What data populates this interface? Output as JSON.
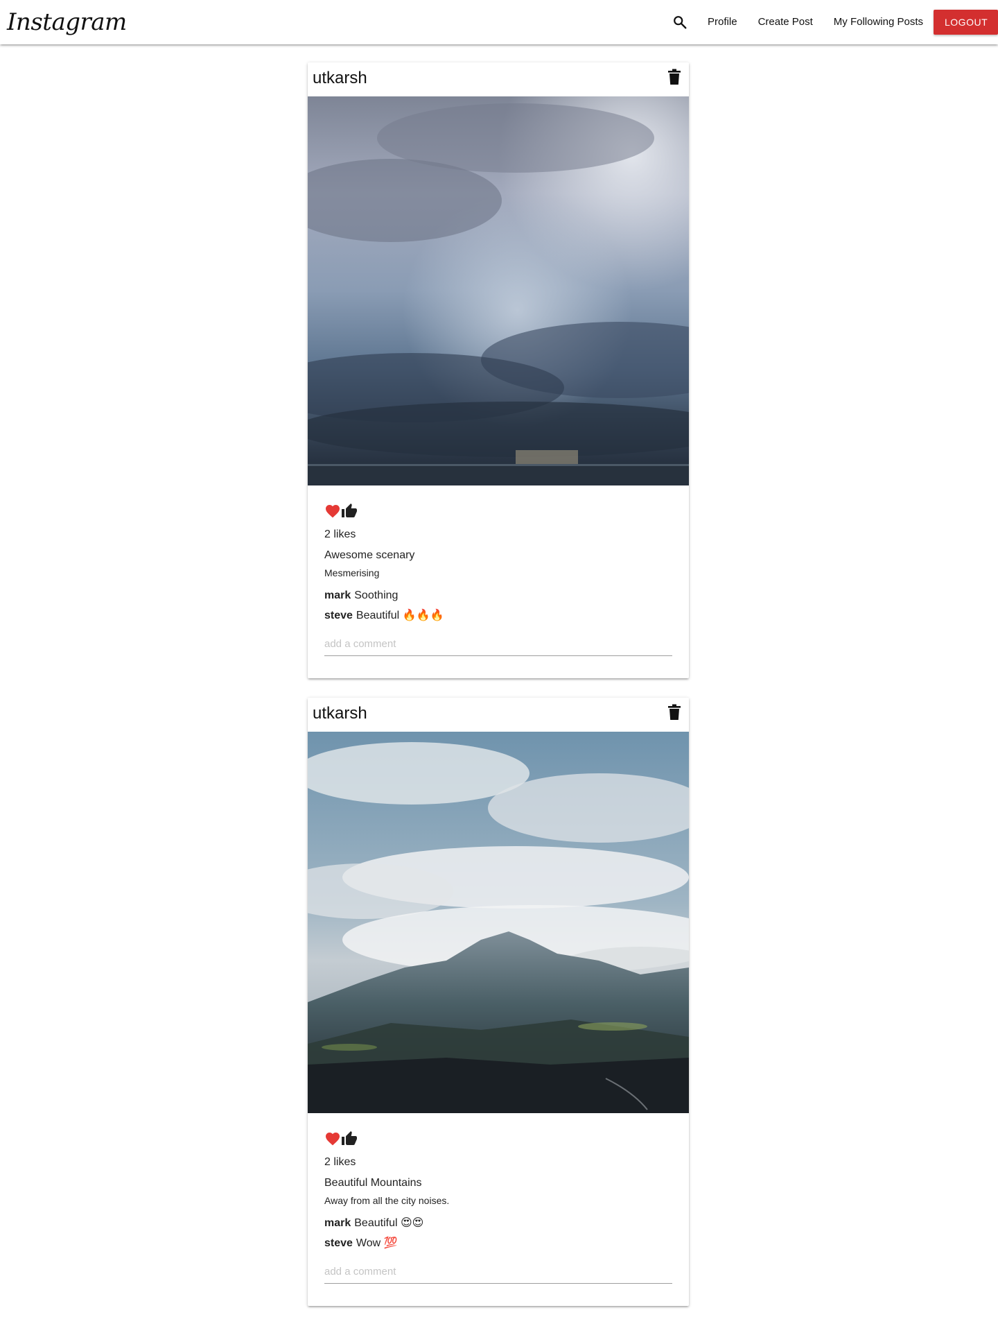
{
  "nav": {
    "brand": "Instagram",
    "search_icon": "search-icon",
    "links": [
      "Profile",
      "Create Post",
      "My Following Posts"
    ],
    "logout_label": "LOGOUT",
    "logout_color": "#d32f2f"
  },
  "posts": [
    {
      "user": "utkarsh",
      "image_alt": "stormy clouds over sea",
      "likes_text": "2 likes",
      "title": "Awesome scenary",
      "body": "Mesmerising",
      "comments": [
        {
          "user": "mark",
          "text": "Soothing"
        },
        {
          "user": "steve",
          "text": "Beautiful 🔥🔥🔥"
        }
      ],
      "comment_placeholder": "add a comment"
    },
    {
      "user": "utkarsh",
      "image_alt": "mountain under clouds",
      "likes_text": "2 likes",
      "title": "Beautiful Mountains",
      "body": "Away from all the city noises.",
      "comments": [
        {
          "user": "mark",
          "text": "Beautiful 😍😍"
        },
        {
          "user": "steve",
          "text": "Wow 💯"
        }
      ],
      "comment_placeholder": "add a comment"
    }
  ],
  "colors": {
    "heart": "#e53935",
    "thumb": "#212121"
  }
}
